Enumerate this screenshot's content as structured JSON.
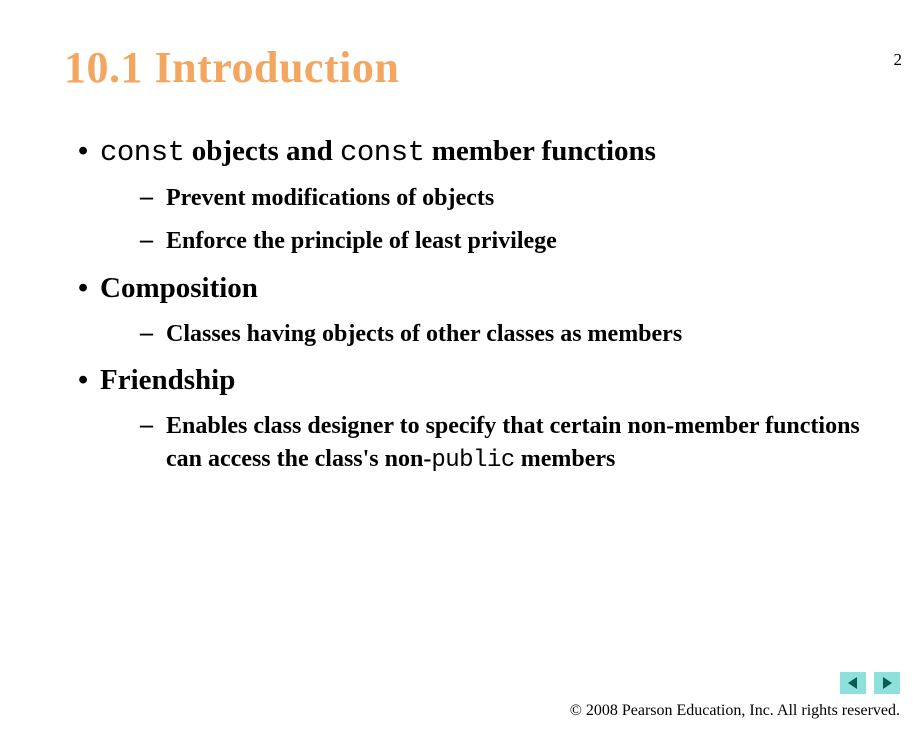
{
  "pageNumber": "2",
  "title": "10.1 Introduction",
  "bullets": [
    {
      "type": "level1",
      "segments": [
        {
          "text": "const",
          "code": true
        },
        {
          "text": " objects and ",
          "code": false
        },
        {
          "text": "const",
          "code": true
        },
        {
          "text": " member functions",
          "code": false
        }
      ],
      "sub": [
        {
          "segments": [
            {
              "text": "Prevent modifications of objects",
              "code": false
            }
          ]
        },
        {
          "segments": [
            {
              "text": "Enforce the principle of least privilege",
              "code": false
            }
          ]
        }
      ]
    },
    {
      "type": "level1",
      "segments": [
        {
          "text": "Composition",
          "code": false
        }
      ],
      "sub": [
        {
          "segments": [
            {
              "text": "Classes having objects of other classes as members",
              "code": false
            }
          ]
        }
      ]
    },
    {
      "type": "level1",
      "segments": [
        {
          "text": "Friendship",
          "code": false
        }
      ],
      "sub": [
        {
          "segments": [
            {
              "text": "Enables class designer to specify that certain non-member functions can access the class's non-",
              "code": false
            },
            {
              "text": "public",
              "code": true
            },
            {
              "text": " members",
              "code": false
            }
          ]
        }
      ]
    }
  ],
  "copyright": "© 2008 Pearson Education, Inc.  All rights reserved.",
  "nav": {
    "prev": "previous-slide",
    "next": "next-slide"
  }
}
